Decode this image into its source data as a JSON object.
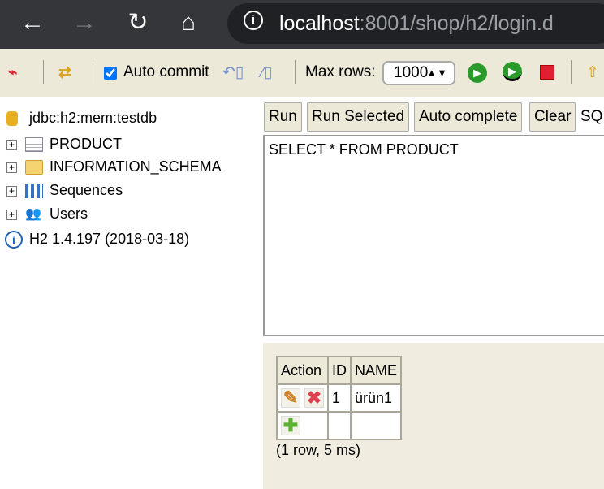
{
  "browser": {
    "url_host": "localhost",
    "url_rest": ":8001/shop/h2/login.d",
    "back": "←",
    "forward": "→",
    "reload": "↻",
    "home": "⌂"
  },
  "toolbar": {
    "auto_commit_label": "Auto commit",
    "auto_commit_checked": true,
    "max_rows_label": "Max rows:",
    "max_rows_value": "1000"
  },
  "tree": {
    "connection": "jdbc:h2:mem:testdb",
    "items": [
      {
        "label": "PRODUCT",
        "icon": "table-icon"
      },
      {
        "label": "INFORMATION_SCHEMA",
        "icon": "folder-icon"
      },
      {
        "label": "Sequences",
        "icon": "sequence-icon"
      },
      {
        "label": "Users",
        "icon": "users-icon"
      }
    ],
    "version": "H2 1.4.197 (2018-03-18)"
  },
  "buttons": {
    "run": "Run",
    "run_selected": "Run Selected",
    "auto_complete": "Auto complete",
    "clear": "Clear",
    "sql_cut": "SQ"
  },
  "sql": "SELECT * FROM PRODUCT",
  "result": {
    "headers": [
      "Action",
      "ID",
      "NAME"
    ],
    "rows": [
      {
        "id": "1",
        "name": "ürün1"
      }
    ],
    "status": "(1 row, 5 ms)"
  }
}
